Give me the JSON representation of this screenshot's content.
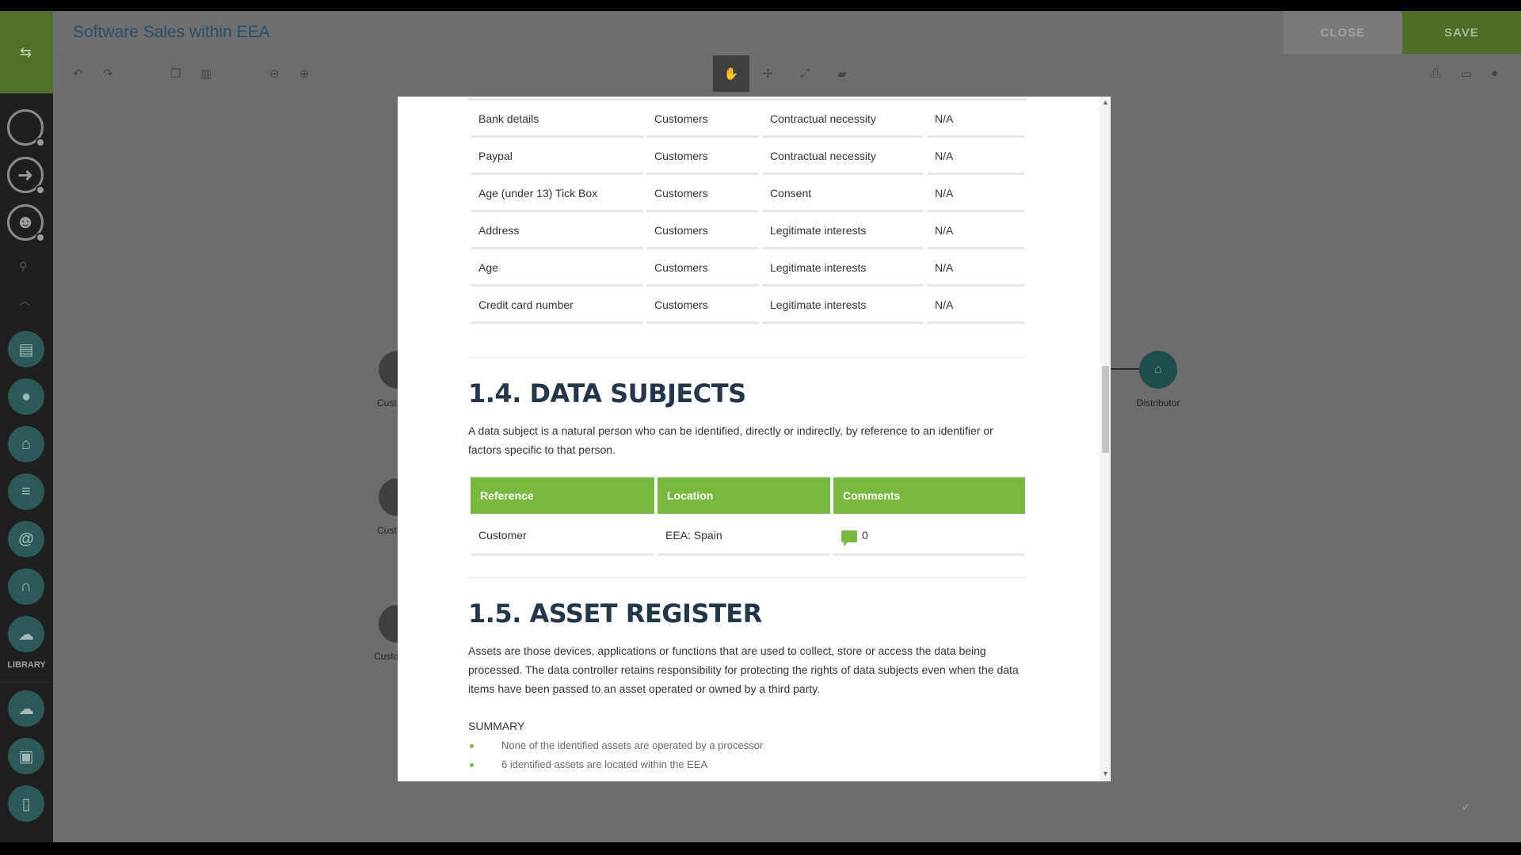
{
  "header": {
    "title": "Software Sales within EEA",
    "close_label": "CLOSE",
    "save_label": "SAVE"
  },
  "sidebar": {
    "library_label": "LIBRARY"
  },
  "canvas": {
    "distributor_label": "Distributor",
    "partial_labels": [
      "Cust",
      "Cust",
      "Custo"
    ]
  },
  "document": {
    "lawful_basis_rows": [
      {
        "field": "Bank details",
        "subject": "Customers",
        "basis": "Contractual necessity",
        "note": "N/A"
      },
      {
        "field": "Paypal",
        "subject": "Customers",
        "basis": "Contractual necessity",
        "note": "N/A"
      },
      {
        "field": "Age (under 13) Tick Box",
        "subject": "Customers",
        "basis": "Consent",
        "note": "N/A"
      },
      {
        "field": "Address",
        "subject": "Customers",
        "basis": "Legitimate interests",
        "note": "N/A"
      },
      {
        "field": "Age",
        "subject": "Customers",
        "basis": "Legitimate interests",
        "note": "N/A"
      },
      {
        "field": "Credit card number",
        "subject": "Customers",
        "basis": "Legitimate interests",
        "note": "N/A"
      }
    ],
    "data_subjects": {
      "title": "1.4. DATA SUBJECTS",
      "description": "A data subject is a natural person who can be identified, directly or indirectly, by reference to an identifier or factors specific to that person.",
      "headers": [
        "Reference",
        "Location",
        "Comments"
      ],
      "rows": [
        {
          "reference": "Customer",
          "location": "EEA: Spain",
          "comments": "0"
        }
      ]
    },
    "asset_register": {
      "title": "1.5. ASSET REGISTER",
      "description": "Assets are those devices, applications or functions that are used to collect, store or access the data being processed. The data controller retains responsibility for protecting the rights of data subjects even when the data items have been passed to an asset operated or owned by a third party.",
      "summary_label": "SUMMARY",
      "summary_items": [
        "None of the identified assets are operated by a processor",
        "6 identified assets are located within the EEA"
      ]
    }
  },
  "colors": {
    "accent_green": "#78b83f",
    "title_blue": "#274d6c",
    "node_teal": "#1e4e4b"
  },
  "icons": {
    "sidebar": [
      "expand-arrows-icon",
      "search-circle-icon",
      "login-arrow-icon",
      "user-profile-icon",
      "search-icon",
      "chevron-up-icon",
      "document-icon",
      "user-icon",
      "bank-icon",
      "database-icon",
      "at-sign-icon",
      "headset-icon",
      "cloud-icon",
      "cloud-icon",
      "archive-icon",
      "mobile-icon"
    ],
    "toolbar": [
      "undo-icon",
      "redo-icon",
      "copy-icon",
      "trash-icon",
      "zoom-out-icon",
      "zoom-in-icon",
      "hand-icon",
      "move-icon",
      "resize-icon",
      "comment-icon",
      "print-icon",
      "image-icon",
      "pin-icon"
    ]
  }
}
